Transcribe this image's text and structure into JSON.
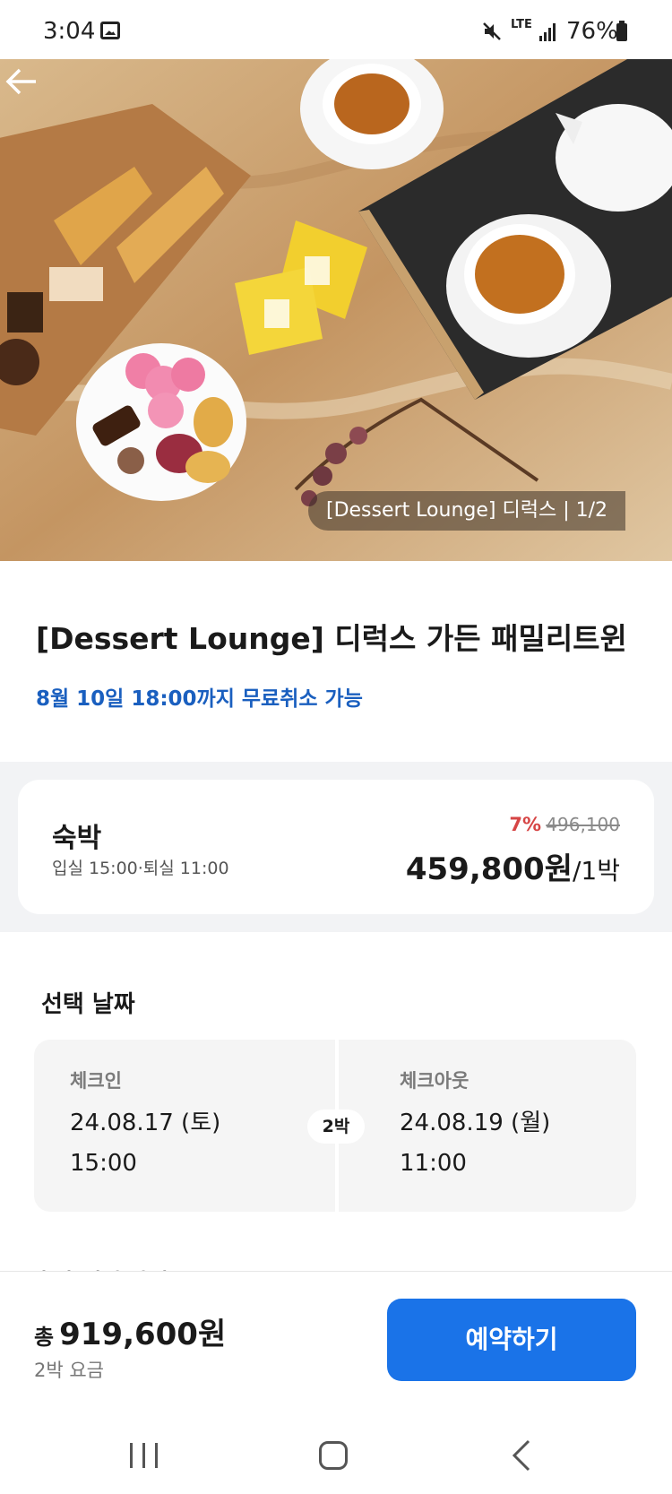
{
  "status_bar": {
    "time": "3:04",
    "network": "LTE",
    "battery": "76%"
  },
  "hero": {
    "caption": "[Dessert Lounge] 디럭스 | 1/2"
  },
  "room": {
    "title": "[Dessert Lounge] 디럭스 가든 패밀리트윈",
    "cancel_note": "8월 10일 18:00까지 무료취소 가능"
  },
  "stay": {
    "label": "숙박",
    "hours": "입실 15:00·퇴실 11:00",
    "discount": "7%",
    "original_price": "496,100",
    "price": "459,800원",
    "price_unit": "/1박"
  },
  "dates": {
    "heading": "선택 날짜",
    "checkin_label": "체크인",
    "checkin_date": "24.08.17 (토)",
    "checkin_time": "15:00",
    "nights": "2박",
    "checkout_label": "체크아웃",
    "checkout_date": "24.08.19 (월)",
    "checkout_time": "11:00"
  },
  "next_section_partial": "추가 혜택 안내",
  "bottom": {
    "total_prefix": "총",
    "total_amount": "919,600원",
    "total_note": "2박 요금",
    "book_label": "예약하기"
  },
  "colors": {
    "accent": "#1a73e8",
    "cancel_note": "#1a5fbf",
    "discount": "#d64545"
  }
}
